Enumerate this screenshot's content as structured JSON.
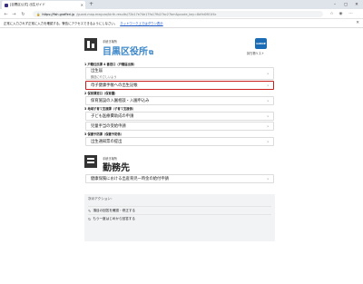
{
  "browser": {
    "tab_title": "[目黒区公式] 出生ガイド",
    "url_host": "https://fish.grafferi.jp",
    "url_path": "/guard-map.meguro/birth-results/72b17e74e17fa17fb27bc27bm&pcode_key=8d9d0f01f4c",
    "infobar_text": "正常に入力されず正常に入力を確認する。警告にアクセスできるようにしなさい。",
    "infobar_link": "ネットワーク上ではダウン表示"
  },
  "header": {
    "office_sub": "手続き場所",
    "office_name": "目黒区役所",
    "guide_badge": "GUIDE",
    "guide_label": "持ち物リスト"
  },
  "sections": [
    {
      "heading": "1 戸籍住民課 4 番窓口（戸籍届出係）",
      "items": [
        {
          "label": "出生届",
          "sub": "郵送にやさしいよう"
        },
        {
          "label": "母子健康手帳への出生記帳",
          "highlight": true
        }
      ]
    },
    {
      "heading": "2 保育課窓口（保育園）",
      "items": [
        {
          "label": "保育施設の入園相談・入園申込み"
        }
      ]
    },
    {
      "heading": "3 地域子育て支援課（子育て支援係）",
      "items": [
        {
          "label": "子ども医療費助成の申請"
        },
        {
          "label": "児童手当の受給申請"
        }
      ]
    },
    {
      "heading": "3 保健予防課（保健予防係）",
      "items": [
        {
          "label": "出生通知票の提出"
        }
      ]
    }
  ],
  "workplace": {
    "sub": "手続き場所",
    "name": "勤務先",
    "items": [
      {
        "label": "健康保険における出産育児一時金の給付申請"
      }
    ]
  },
  "actions": {
    "title": "次のアクション：",
    "items": [
      {
        "label": "項目の回答を確認・修正する",
        "icon": "edit-icon"
      },
      {
        "label": "もう一度はじめから回答する",
        "icon": "refresh-icon"
      }
    ]
  }
}
